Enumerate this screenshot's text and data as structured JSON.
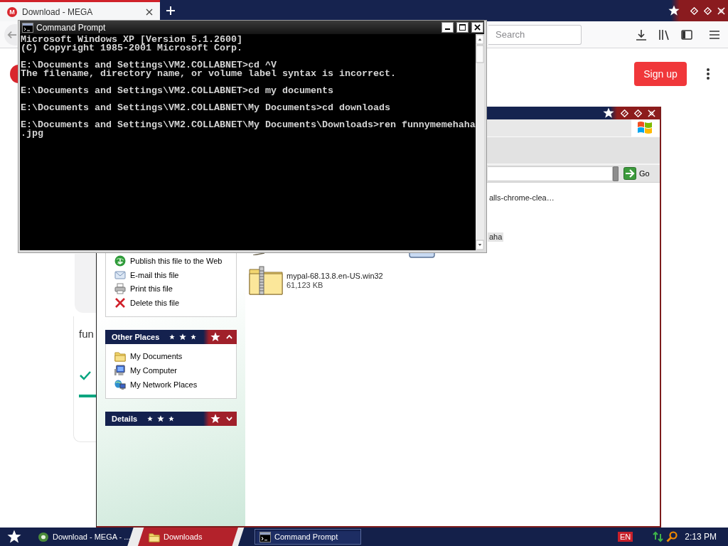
{
  "browser": {
    "tabs": [
      {
        "label": "Download - MEGA",
        "logo": "M",
        "selected": true
      }
    ],
    "search": {
      "placeholder": "Search"
    },
    "page": {
      "signup": "Sign up",
      "card_title": "fun"
    }
  },
  "explorer": {
    "task_panels": [
      {
        "items": [
          {
            "kind": "publish",
            "label": "Publish this file to the Web"
          },
          {
            "kind": "email",
            "label": "E-mail this file"
          },
          {
            "kind": "print",
            "label": "Print this file"
          },
          {
            "kind": "delete",
            "label": "Delete this file"
          }
        ]
      },
      {
        "title": "Other Places",
        "expanded": true,
        "items": [
          {
            "kind": "documents",
            "label": "My Documents"
          },
          {
            "kind": "computer",
            "label": "My Computer"
          },
          {
            "kind": "network",
            "label": "My Network Places"
          }
        ]
      },
      {
        "title": "Details",
        "expanded": false
      }
    ],
    "address": {
      "go": "Go"
    },
    "files": [
      {
        "kind": "partial",
        "name": "alls-chrome-clea…",
        "selected": false
      },
      {
        "kind": "image",
        "name": "aha",
        "selected": true
      },
      {
        "kind": "zip",
        "name": "mypal-68.13.8.en-US.win32",
        "size": "61,123 KB",
        "selected": false
      }
    ]
  },
  "console": {
    "title": "Command Prompt",
    "banner": [
      "Microsoft Windows XP [Version 5.1.2600]",
      "(C) Copyright 1985-2001 Microsoft Corp."
    ],
    "entries": [
      {
        "input": "E:\\Documents and Settings\\VM2.COLLABNET>cd ^V",
        "output": [
          "The filename, directory name, or volume label syntax is incorrect."
        ]
      },
      {
        "input": "E:\\Documents and Settings\\VM2.COLLABNET>cd my documents"
      },
      {
        "input": "E:\\Documents and Settings\\VM2.COLLABNET\\My Documents>cd downloads"
      },
      {
        "input": "E:\\Documents and Settings\\VM2.COLLABNET\\My Documents\\Downloads>ren funnymemehaha.jpg"
      }
    ]
  },
  "taskbar": {
    "tasks": [
      {
        "kind": "browser",
        "label": "Download - MEGA - ...",
        "selected": false
      },
      {
        "kind": "folder",
        "label": "Downloads",
        "selected": false
      },
      {
        "kind": "console",
        "label": "Command Prompt",
        "selected": true
      }
    ],
    "language": "EN",
    "clock": "2:13 PM"
  }
}
